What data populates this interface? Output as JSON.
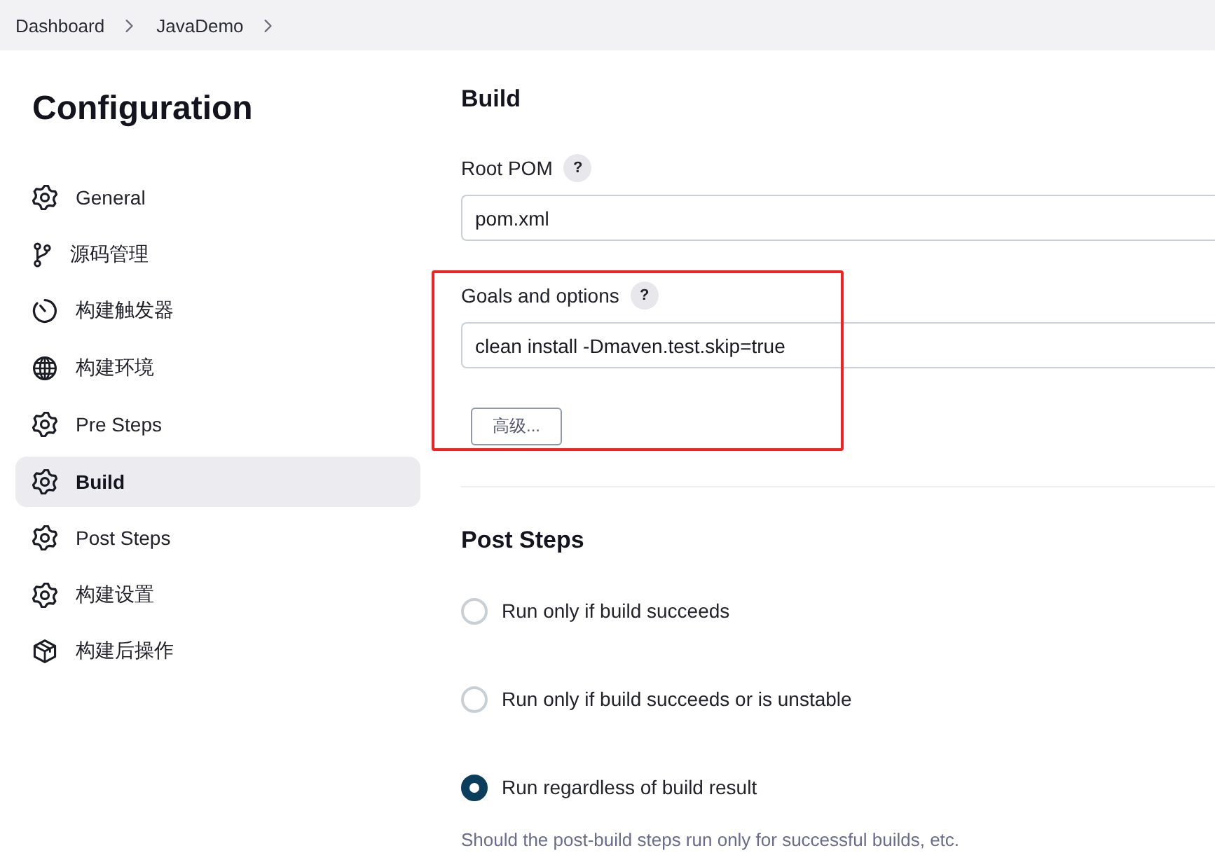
{
  "breadcrumbs": [
    {
      "label": "Dashboard"
    },
    {
      "label": "JavaDemo"
    }
  ],
  "page_title": "Configuration",
  "sidebar": {
    "items": [
      {
        "label": "General",
        "kind": "gear",
        "selected": false
      },
      {
        "label": "源码管理",
        "kind": "branch",
        "selected": false
      },
      {
        "label": "构建触发器",
        "kind": "timer",
        "selected": false
      },
      {
        "label": "构建环境",
        "kind": "globe",
        "selected": false
      },
      {
        "label": "Pre Steps",
        "kind": "gear",
        "selected": false
      },
      {
        "label": "Build",
        "kind": "gear",
        "selected": true
      },
      {
        "label": "Post Steps",
        "kind": "gear",
        "selected": false
      },
      {
        "label": "构建设置",
        "kind": "gear",
        "selected": false
      },
      {
        "label": "构建后操作",
        "kind": "package",
        "selected": false
      }
    ]
  },
  "build": {
    "heading": "Build",
    "fields": [
      {
        "label": "Root POM",
        "help": "?",
        "value": "pom.xml",
        "highlighted": false
      },
      {
        "label": "Goals and options",
        "help": "?",
        "value": "clean install -Dmaven.test.skip=true",
        "highlighted": true,
        "advanced_button": "高级..."
      }
    ]
  },
  "post_steps": {
    "heading": "Post Steps",
    "options": [
      {
        "label": "Run only if build succeeds",
        "selected": false
      },
      {
        "label": "Run only if build succeeds or is unstable",
        "selected": false
      },
      {
        "label": "Run regardless of build result",
        "selected": true
      }
    ],
    "description": "Should the post-build steps run only for successful builds, etc."
  }
}
